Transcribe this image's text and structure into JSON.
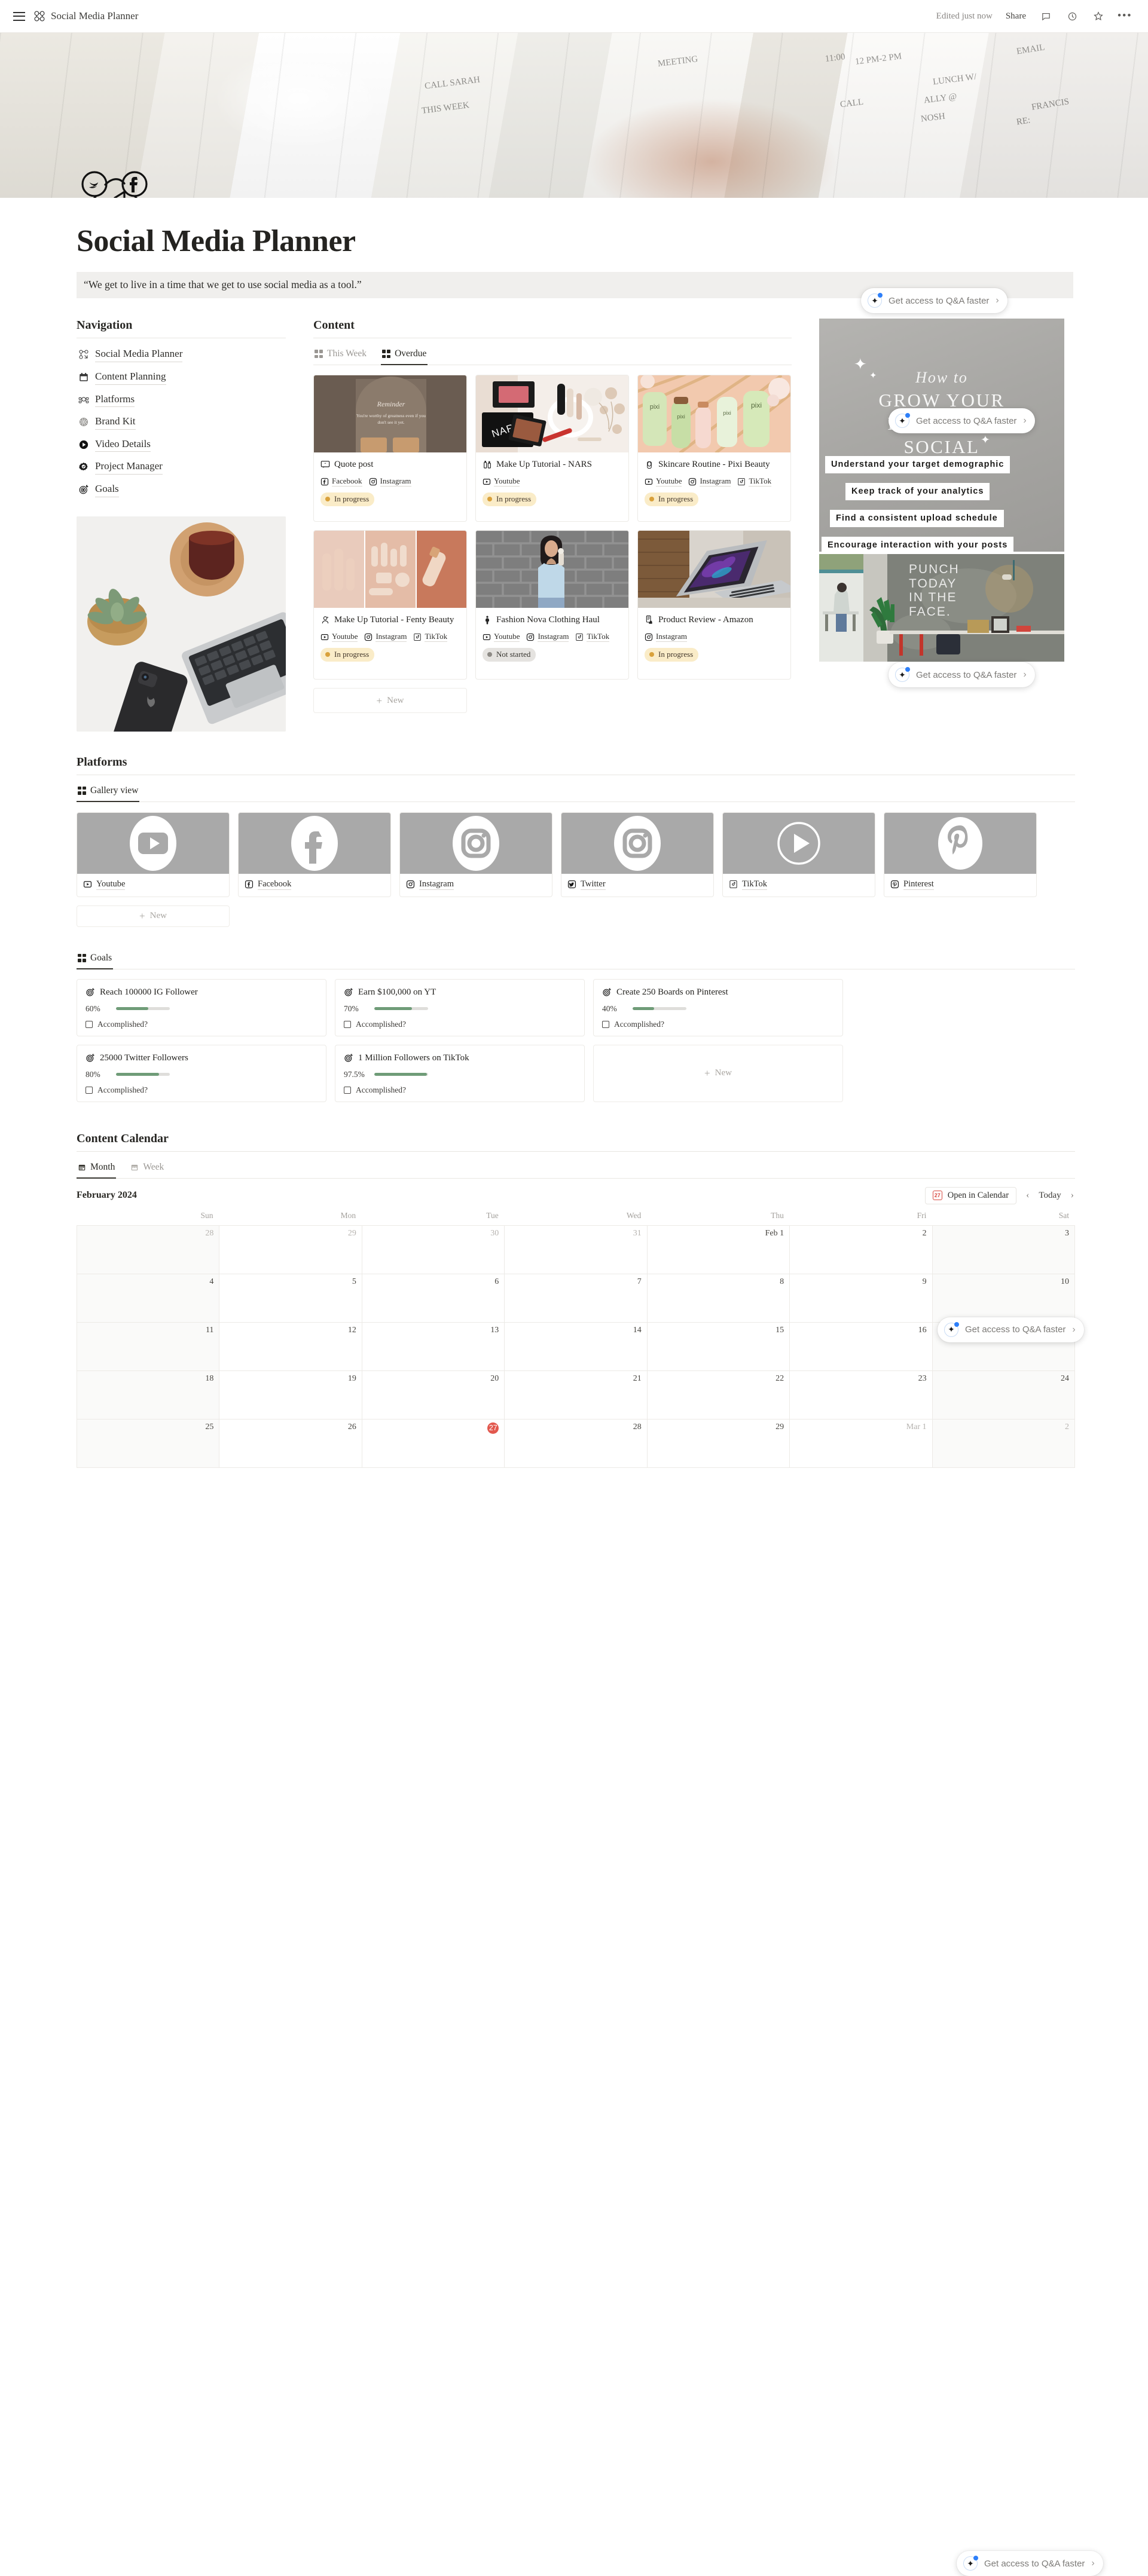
{
  "topbar": {
    "title": "Social Media Planner",
    "edited": "Edited just now",
    "share": "Share",
    "icons": [
      "menu-icon",
      "comment-icon",
      "history-clock-icon",
      "star-icon",
      "more-options-icon"
    ]
  },
  "page": {
    "title": "Social Media Planner",
    "quote": "“We get to live in a time that we get to use social media as a tool.”"
  },
  "navigation": {
    "heading": "Navigation",
    "items": [
      {
        "label": "Social Media Planner",
        "icon": "social-cluster-icon"
      },
      {
        "label": "Content Planning",
        "icon": "calendar-icon"
      },
      {
        "label": "Platforms",
        "icon": "network-icon"
      },
      {
        "label": "Brand Kit",
        "icon": "mandala-icon"
      },
      {
        "label": "Video Details",
        "icon": "play-circle-icon"
      },
      {
        "label": "Project Manager",
        "icon": "gear-check-icon"
      },
      {
        "label": "Goals",
        "icon": "target-icon"
      }
    ]
  },
  "content": {
    "heading": "Content",
    "tabs": [
      {
        "label": "This Week",
        "active": false
      },
      {
        "label": "Overdue",
        "active": true
      }
    ],
    "new_label": "New",
    "cards": [
      {
        "title": "Quote post",
        "icon": "quote-bubble-icon",
        "thumb": "quote-reminder-graphic",
        "thumb_text": "Reminder\nYou're worthy of greatness even if you don't see it yet.",
        "platforms": [
          {
            "name": "Facebook",
            "icon": "facebook-icon"
          },
          {
            "name": "Instagram",
            "icon": "instagram-icon"
          }
        ],
        "status": "In progress",
        "status_kind": "inprogress"
      },
      {
        "title": "Make Up Tutorial - NARS",
        "icon": "cosmetics-icon",
        "thumb": "nars-makeup-flatlay",
        "thumb_text": "NARS",
        "platforms": [
          {
            "name": "Youtube",
            "icon": "youtube-icon"
          }
        ],
        "status": "In progress",
        "status_kind": "inprogress"
      },
      {
        "title": "Skincare Routine - Pixi Beauty",
        "icon": "woman-face-icon",
        "thumb": "pixi-skincare-flatlay",
        "thumb_text": "pixi",
        "platforms": [
          {
            "name": "Youtube",
            "icon": "youtube-icon"
          },
          {
            "name": "Instagram",
            "icon": "instagram-icon"
          },
          {
            "name": "TikTok",
            "icon": "tiktok-icon"
          }
        ],
        "status": "In progress",
        "status_kind": "inprogress"
      },
      {
        "title": "Make Up Tutorial - Fenty Beauty",
        "icon": "makeup-artist-icon",
        "thumb": "fenty-product-triptych",
        "thumb_text": "",
        "platforms": [
          {
            "name": "Youtube",
            "icon": "youtube-icon"
          },
          {
            "name": "Instagram",
            "icon": "instagram-icon"
          },
          {
            "name": "TikTok",
            "icon": "tiktok-icon"
          }
        ],
        "status": "In progress",
        "status_kind": "inprogress"
      },
      {
        "title": "Fashion Nova Clothing Haul",
        "icon": "person-standing-icon",
        "thumb": "woman-brick-wall-photo",
        "thumb_text": "",
        "platforms": [
          {
            "name": "Youtube",
            "icon": "youtube-icon"
          },
          {
            "name": "Instagram",
            "icon": "instagram-icon"
          },
          {
            "name": "TikTok",
            "icon": "tiktok-icon"
          }
        ],
        "status": "Not started",
        "status_kind": "notstarted"
      },
      {
        "title": "Product Review - Amazon",
        "icon": "phone-hand-icon",
        "thumb": "laptop-desk-photo",
        "thumb_text": "",
        "platforms": [
          {
            "name": "Instagram",
            "icon": "instagram-icon"
          }
        ],
        "status": "In progress",
        "status_kind": "inprogress"
      }
    ]
  },
  "sidebar_media": {
    "story": {
      "script_line": "How to",
      "headline": "GROW YOUR\nBRAND ON\nSOCIAL",
      "strips": [
        "Understand your target demographic",
        "Keep track of your analytics",
        "Find a consistent upload schedule",
        "Encourage interaction with your posts"
      ]
    },
    "office": {
      "wall_text": "PUNCH\nTODAY\nIN THE\nFACE."
    }
  },
  "platforms": {
    "heading": "Platforms",
    "tabs": [
      {
        "label": "Gallery view",
        "active": true
      }
    ],
    "new_label": "New",
    "items": [
      {
        "name": "Youtube",
        "icon": "youtube-icon",
        "logo": "youtube-logo"
      },
      {
        "name": "Facebook",
        "icon": "facebook-icon",
        "logo": "facebook-logo"
      },
      {
        "name": "Instagram",
        "icon": "instagram-icon",
        "logo": "instagram-logo"
      },
      {
        "name": "Twitter",
        "icon": "twitter-icon",
        "logo": "instagram-logo"
      },
      {
        "name": "TikTok",
        "icon": "tiktok-icon",
        "logo": "play-circle-logo"
      },
      {
        "name": "Pinterest",
        "icon": "pinterest-icon",
        "logo": "pinterest-logo"
      }
    ]
  },
  "goals": {
    "tabs": [
      {
        "label": "Goals",
        "active": true
      }
    ],
    "new_label": "New",
    "check_label": "Accomplished?",
    "accent_color": "#6f9c78",
    "items": [
      {
        "title": "Reach 100000 IG Follower",
        "percent": "60%",
        "value": 60,
        "accomplished": false
      },
      {
        "title": "Earn $100,000 on YT",
        "percent": "70%",
        "value": 70,
        "accomplished": false
      },
      {
        "title": "Create 250 Boards on Pinterest",
        "percent": "40%",
        "value": 40,
        "accomplished": false
      },
      {
        "title": "25000 Twitter Followers",
        "percent": "80%",
        "value": 80,
        "accomplished": false
      },
      {
        "title": "1 Million Followers on TikTok",
        "percent": "97.5%",
        "value": 97.5,
        "accomplished": false
      }
    ]
  },
  "calendar": {
    "heading": "Content Calendar",
    "tabs": [
      {
        "label": "Month",
        "active": true
      },
      {
        "label": "Week",
        "active": false
      }
    ],
    "month_label": "February 2024",
    "open_in_calendar": "Open in Calendar",
    "today_label": "Today",
    "calendar_icon_day": "27",
    "today_date": 27,
    "weekdays": [
      "Sun",
      "Mon",
      "Tue",
      "Wed",
      "Thu",
      "Fri",
      "Sat"
    ],
    "weeks": [
      [
        {
          "label": "28",
          "dim": true
        },
        {
          "label": "29",
          "dim": true
        },
        {
          "label": "30",
          "dim": true
        },
        {
          "label": "31",
          "dim": true
        },
        {
          "label": "Feb 1",
          "dim": false
        },
        {
          "label": "2",
          "dim": false
        },
        {
          "label": "3",
          "dim": false
        }
      ],
      [
        {
          "label": "4",
          "dim": false
        },
        {
          "label": "5",
          "dim": false
        },
        {
          "label": "6",
          "dim": false
        },
        {
          "label": "7",
          "dim": false
        },
        {
          "label": "8",
          "dim": false
        },
        {
          "label": "9",
          "dim": false
        },
        {
          "label": "10",
          "dim": false
        }
      ],
      [
        {
          "label": "11",
          "dim": false
        },
        {
          "label": "12",
          "dim": false
        },
        {
          "label": "13",
          "dim": false
        },
        {
          "label": "14",
          "dim": false
        },
        {
          "label": "15",
          "dim": false
        },
        {
          "label": "16",
          "dim": false
        },
        {
          "label": "17",
          "dim": false
        }
      ],
      [
        {
          "label": "18",
          "dim": false
        },
        {
          "label": "19",
          "dim": false
        },
        {
          "label": "20",
          "dim": false
        },
        {
          "label": "21",
          "dim": false
        },
        {
          "label": "22",
          "dim": false
        },
        {
          "label": "23",
          "dim": false
        },
        {
          "label": "24",
          "dim": false
        }
      ],
      [
        {
          "label": "25",
          "dim": false
        },
        {
          "label": "26",
          "dim": false
        },
        {
          "label": "27",
          "dim": false,
          "today": true
        },
        {
          "label": "28",
          "dim": false
        },
        {
          "label": "29",
          "dim": false
        },
        {
          "label": "Mar 1",
          "dim": true
        },
        {
          "label": "2",
          "dim": true
        }
      ]
    ]
  },
  "qa_pill": {
    "label": "Get access to Q&A faster",
    "icon": "ai-sparkle-icon",
    "chevron": "›"
  }
}
